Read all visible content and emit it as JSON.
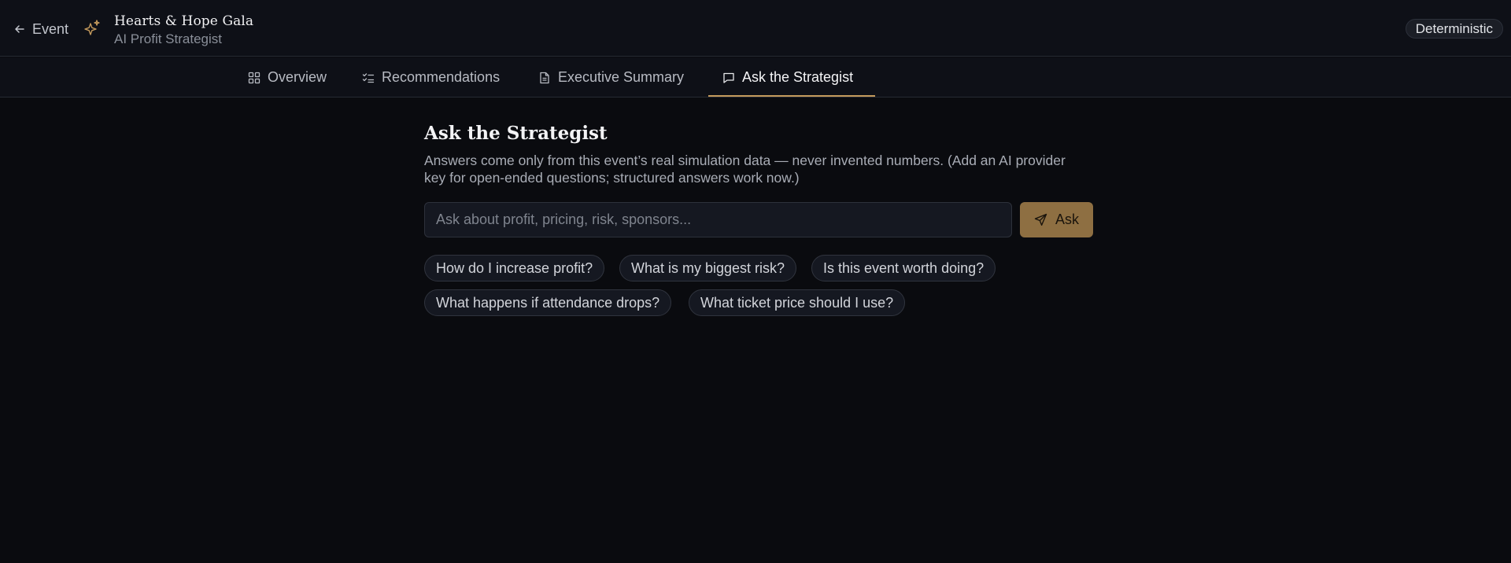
{
  "header": {
    "back_label": "Event",
    "title": "Hearts & Hope Gala",
    "subtitle": "AI Profit Strategist",
    "mode_badge": "Deterministic"
  },
  "tabs": [
    {
      "label": "Overview",
      "icon": "grid-icon",
      "active": false
    },
    {
      "label": "Recommendations",
      "icon": "checklist-icon",
      "active": false
    },
    {
      "label": "Executive Summary",
      "icon": "document-icon",
      "active": false
    },
    {
      "label": "Ask the Strategist",
      "icon": "chat-icon",
      "active": true
    }
  ],
  "main": {
    "title": "Ask the Strategist",
    "description": "Answers come only from this event’s real simulation data — never invented numbers. (Add an AI provider key for open-ended questions; structured answers work now.)",
    "input_placeholder": "Ask about profit, pricing, risk, sponsors...",
    "input_value": "",
    "ask_label": "Ask",
    "suggestions": [
      "How do I increase profit?",
      "What is my biggest risk?",
      "Is this event worth doing?",
      "What happens if attendance drops?",
      "What ticket price should I use?"
    ]
  },
  "colors": {
    "background": "#0a0b0f",
    "accent": "#c49a5c",
    "ask_button": "#8e6f42"
  }
}
